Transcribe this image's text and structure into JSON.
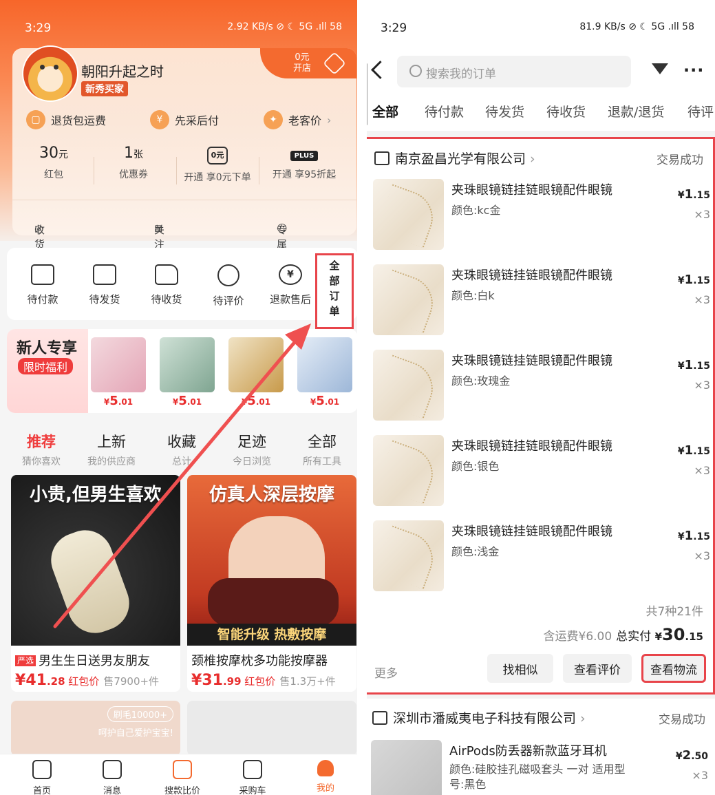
{
  "left": {
    "status": {
      "time": "3:29",
      "icons": "2.92 KB/s ⊘ ☾ 5G .ıll 58"
    },
    "profile": {
      "name": "朝阳升起之时",
      "badge": "新秀买家",
      "open_shop": "0元\n开店"
    },
    "perks": [
      "退货包运费",
      "先采后付",
      "老客价"
    ],
    "stats": [
      {
        "num": "30",
        "unit": "元",
        "label": "红包"
      },
      {
        "num": "1",
        "unit": "张",
        "label": "优惠券"
      },
      {
        "num": "",
        "unit": "",
        "label": "开通 享0元下单",
        "icon": "0元"
      },
      {
        "num": "",
        "unit": "",
        "label": "开通 享95折起",
        "icon": "PLUS"
      }
    ],
    "links": [
      "收货地址",
      "关注店铺",
      "专属客服"
    ],
    "orders": [
      "待付款",
      "待发货",
      "待收货",
      "待评价",
      "退款售后"
    ],
    "all_orders": "全部订单",
    "new_user": {
      "title": "新人专享",
      "tag": "限时福利",
      "price_symbol": "¥",
      "price_int": "5",
      "price_dec": ".01"
    },
    "feed_tabs": [
      {
        "a": "推荐",
        "b": "猜你喜欢"
      },
      {
        "a": "上新",
        "b": "我的供应商"
      },
      {
        "a": "收藏",
        "b": "总计"
      },
      {
        "a": "足迹",
        "b": "今日浏览"
      },
      {
        "a": "全部",
        "b": "所有工具"
      }
    ],
    "products": [
      {
        "overlay": "小贵,但男生喜欢",
        "tag": "严选",
        "title": "男生生日送男友朋友",
        "price_int": "41",
        "price_dec": ".28",
        "ship": "红包价",
        "sold": "售7900+件"
      },
      {
        "overlay": "仿真人深层按摩",
        "footer": "智能升级 热敷按摩",
        "title": "颈椎按摩枕多功能按摩器",
        "price_int": "31",
        "price_dec": ".99",
        "ship": "红包价",
        "sold": "售1.3万+件"
      }
    ],
    "product3_badge": "刷毛10000+",
    "product3_sub": "呵护自己爱护宝宝!",
    "nav": [
      "首页",
      "消息",
      "搜款比价",
      "采购车",
      "我的"
    ]
  },
  "right": {
    "status": {
      "time": "3:29",
      "icons": "81.9 KB/s ⊘ ☾ 5G .ıll 58"
    },
    "search_placeholder": "搜索我的订单",
    "tabs": [
      "全部",
      "待付款",
      "待发货",
      "待收货",
      "退款/退货",
      "待评"
    ],
    "order1": {
      "shop": "南京盈昌光学有限公司",
      "state": "交易成功",
      "items": [
        {
          "name": "夹珠眼镜链挂链眼镜配件眼镜",
          "color": "颜色:kc金",
          "price_int": "1",
          "price_dec": ".15",
          "qty": "×3"
        },
        {
          "name": "夹珠眼镜链挂链眼镜配件眼镜",
          "color": "颜色:白k",
          "price_int": "1",
          "price_dec": ".15",
          "qty": "×3"
        },
        {
          "name": "夹珠眼镜链挂链眼镜配件眼镜",
          "color": "颜色:玫瑰金",
          "price_int": "1",
          "price_dec": ".15",
          "qty": "×3"
        },
        {
          "name": "夹珠眼镜链挂链眼镜配件眼镜",
          "color": "颜色:银色",
          "price_int": "1",
          "price_dec": ".15",
          "qty": "×3"
        },
        {
          "name": "夹珠眼镜链挂链眼镜配件眼镜",
          "color": "颜色:浅金",
          "price_int": "1",
          "price_dec": ".15",
          "qty": "×3"
        }
      ],
      "summary_count": "共7种21件",
      "shipping": "含运费¥6.00",
      "total_label": "总实付",
      "total_int": "30",
      "total_dec": ".15",
      "more": "更多",
      "buttons": [
        "找相似",
        "查看评价",
        "查看物流"
      ]
    },
    "order2": {
      "shop": "深圳市潘威夷电子科技有限公司",
      "state": "交易成功",
      "item": {
        "name": "AirPods防丢器新款蓝牙耳机",
        "color": "颜色:硅胶挂孔磁吸套头 一对 适用型号:黑色",
        "price_int": "2",
        "price_dec": ".50",
        "qty": "×3"
      }
    }
  },
  "colors": {
    "accent": "#f46a2f",
    "highlight": "#e8444a",
    "price": "#e82d2d"
  }
}
